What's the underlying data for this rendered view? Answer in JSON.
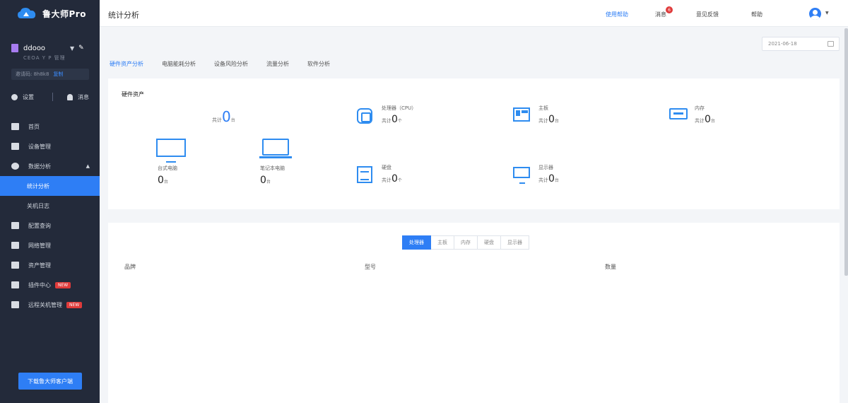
{
  "app": {
    "name": "鲁大师Pro"
  },
  "sidebar": {
    "account_name": "ddooo",
    "account_sub": "CEOA Y P 管理",
    "account_box_label": "邀请码: 8h8k8",
    "account_box_link": "复制",
    "quick_left": "设置",
    "quick_right": "消息",
    "menu": {
      "m1": "首页",
      "m2": "设备管理",
      "m3": "数据分析",
      "m3_sub1": "统计分析",
      "m3_sub2": "关机日志",
      "m4": "配置查询",
      "m5": "网络管理",
      "m6": "资产管理",
      "m7": "插件中心",
      "m7_badge": "NEW",
      "m8": "远程关机管理",
      "m8_badge": "NEW"
    },
    "download_label": "下载鲁大师客户端"
  },
  "header": {
    "title": "统计分析",
    "link_help": "使用帮助",
    "link_msg": "消息",
    "msg_count": "6",
    "link_feedback": "意见反馈",
    "link_about": "帮助"
  },
  "date_picker": {
    "value": "2021-06-18"
  },
  "tabs": [
    "硬件资产分析",
    "电脑能耗分析",
    "设备风险分析",
    "流量分析",
    "软件分析"
  ],
  "assets": {
    "title": "硬件资产",
    "total_label": "共计",
    "total_value": "0",
    "total_unit": "台",
    "cpu_label": "处理器（CPU）",
    "cpu_prefix": "共计",
    "cpu_value": "0",
    "cpu_unit": "个",
    "board_label": "主板",
    "board_prefix": "共计",
    "board_value": "0",
    "board_unit": "台",
    "mem_label": "内存",
    "mem_prefix": "共计",
    "mem_value": "0",
    "mem_unit": "台",
    "desktop_label": "台式电脑",
    "desktop_value": "0",
    "desktop_unit": "台",
    "laptop_label": "笔记本电脑",
    "laptop_value": "0",
    "laptop_unit": "台",
    "disk_label": "硬盘",
    "disk_prefix": "共计",
    "disk_value": "0",
    "disk_unit": "个",
    "monitor_label": "显示器",
    "monitor_prefix": "共计",
    "monitor_value": "0",
    "monitor_unit": "台"
  },
  "detail": {
    "segments": [
      "处理器",
      "主板",
      "内存",
      "硬盘",
      "显示器"
    ],
    "columns": [
      "品牌",
      "型号",
      "数量"
    ]
  },
  "colors": {
    "accent": "#2e7ef5",
    "sidebar_bg": "#232a3a",
    "badge": "#e03b3b"
  }
}
